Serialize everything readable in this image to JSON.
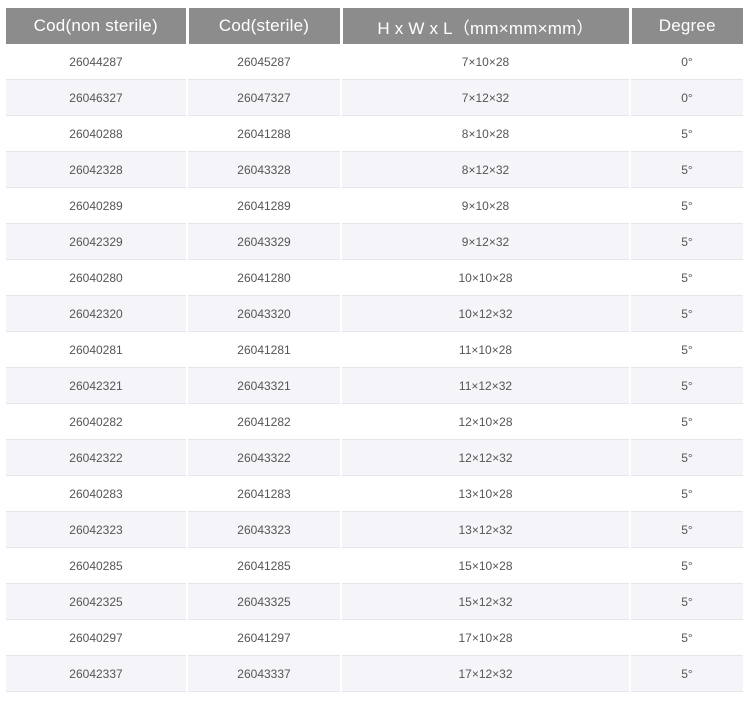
{
  "table": {
    "headers": [
      "Cod(non sterile)",
      "Cod(sterile)",
      "H x W x L（mm×mm×mm）",
      "Degree"
    ],
    "rows": [
      [
        "26044287",
        "26045287",
        "7×10×28",
        "0°"
      ],
      [
        "26046327",
        "26047327",
        "7×12×32",
        "0°"
      ],
      [
        "26040288",
        "26041288",
        "8×10×28",
        "5°"
      ],
      [
        "26042328",
        "26043328",
        "8×12×32",
        "5°"
      ],
      [
        "26040289",
        "26041289",
        "9×10×28",
        "5°"
      ],
      [
        "26042329",
        "26043329",
        "9×12×32",
        "5°"
      ],
      [
        "26040280",
        "26041280",
        "10×10×28",
        "5°"
      ],
      [
        "26042320",
        "26043320",
        "10×12×32",
        "5°"
      ],
      [
        "26040281",
        "26041281",
        "11×10×28",
        "5°"
      ],
      [
        "26042321",
        "26043321",
        "11×12×32",
        "5°"
      ],
      [
        "26040282",
        "26041282",
        "12×10×28",
        "5°"
      ],
      [
        "26042322",
        "26043322",
        "12×12×32",
        "5°"
      ],
      [
        "26040283",
        "26041283",
        "13×10×28",
        "5°"
      ],
      [
        "26042323",
        "26043323",
        "13×12×32",
        "5°"
      ],
      [
        "26040285",
        "26041285",
        "15×10×28",
        "5°"
      ],
      [
        "26042325",
        "26043325",
        "15×12×32",
        "5°"
      ],
      [
        "26040297",
        "26041297",
        "17×10×28",
        "5°"
      ],
      [
        "26042337",
        "26043337",
        "17×12×32",
        "5°"
      ]
    ]
  },
  "colors": {
    "header_background": "#8c8c8c",
    "header_text": "#ffffff",
    "stripe_background": "#f4f4f9",
    "cell_text": "#555555"
  }
}
